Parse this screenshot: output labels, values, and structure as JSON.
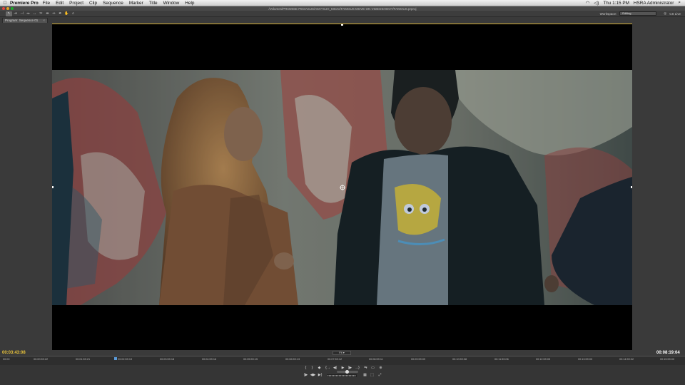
{
  "menubar": {
    "app_name": "Premiere Pro",
    "items": [
      "File",
      "Edit",
      "Project",
      "Clip",
      "Sequence",
      "Marker",
      "Title",
      "Window",
      "Help"
    ],
    "clock": "Thu 1:15 PM",
    "user": "HSRA Administrator"
  },
  "window": {
    "title": "/Volumes/PROMISE PEGASUS/AM FSUH_MICKI/FAMOUS MOVE ON VIDEOSHOOT/FAMOUS.prproj"
  },
  "workspace": {
    "label": "Workspace:",
    "value": "Editing",
    "cs_live": "CS Live"
  },
  "panel": {
    "tab_label": "Program: Sequence 01",
    "close": "×"
  },
  "monitor": {
    "current_timecode": "00:03:43:08",
    "duration_timecode": "00:08:19:04",
    "fit_label": "Fit",
    "fit_options": [
      "Fit"
    ]
  },
  "ruler": {
    "labels": [
      "00:00",
      "00:00:59:22",
      "00:01:59:21",
      "00:02:59:19",
      "00:03:59:18",
      "00:04:59:16",
      "00:05:59:15",
      "00:06:59:13",
      "00:07:59:12",
      "00:08:59:11",
      "00:09:59:09",
      "00:10:59:08",
      "00:11:59:06",
      "00:12:59:05",
      "00:13:59:03",
      "00:14:59:02",
      "00:15:59:00"
    ]
  },
  "transport": {
    "row1": [
      "{",
      "}",
      "◆",
      "{→",
      "◀|",
      "▶",
      "|▶",
      "→}",
      "⇆",
      "▭",
      "⊕"
    ],
    "row2": [
      "{▶",
      "◀▶",
      "▶}",
      "▦",
      "⬚",
      "⤢"
    ]
  },
  "colors": {
    "timecode_yellow": "#e8c23a",
    "timecode_white": "#ffffff",
    "viewer_border": "#d6b23a",
    "playhead": "#5a9ad8"
  }
}
